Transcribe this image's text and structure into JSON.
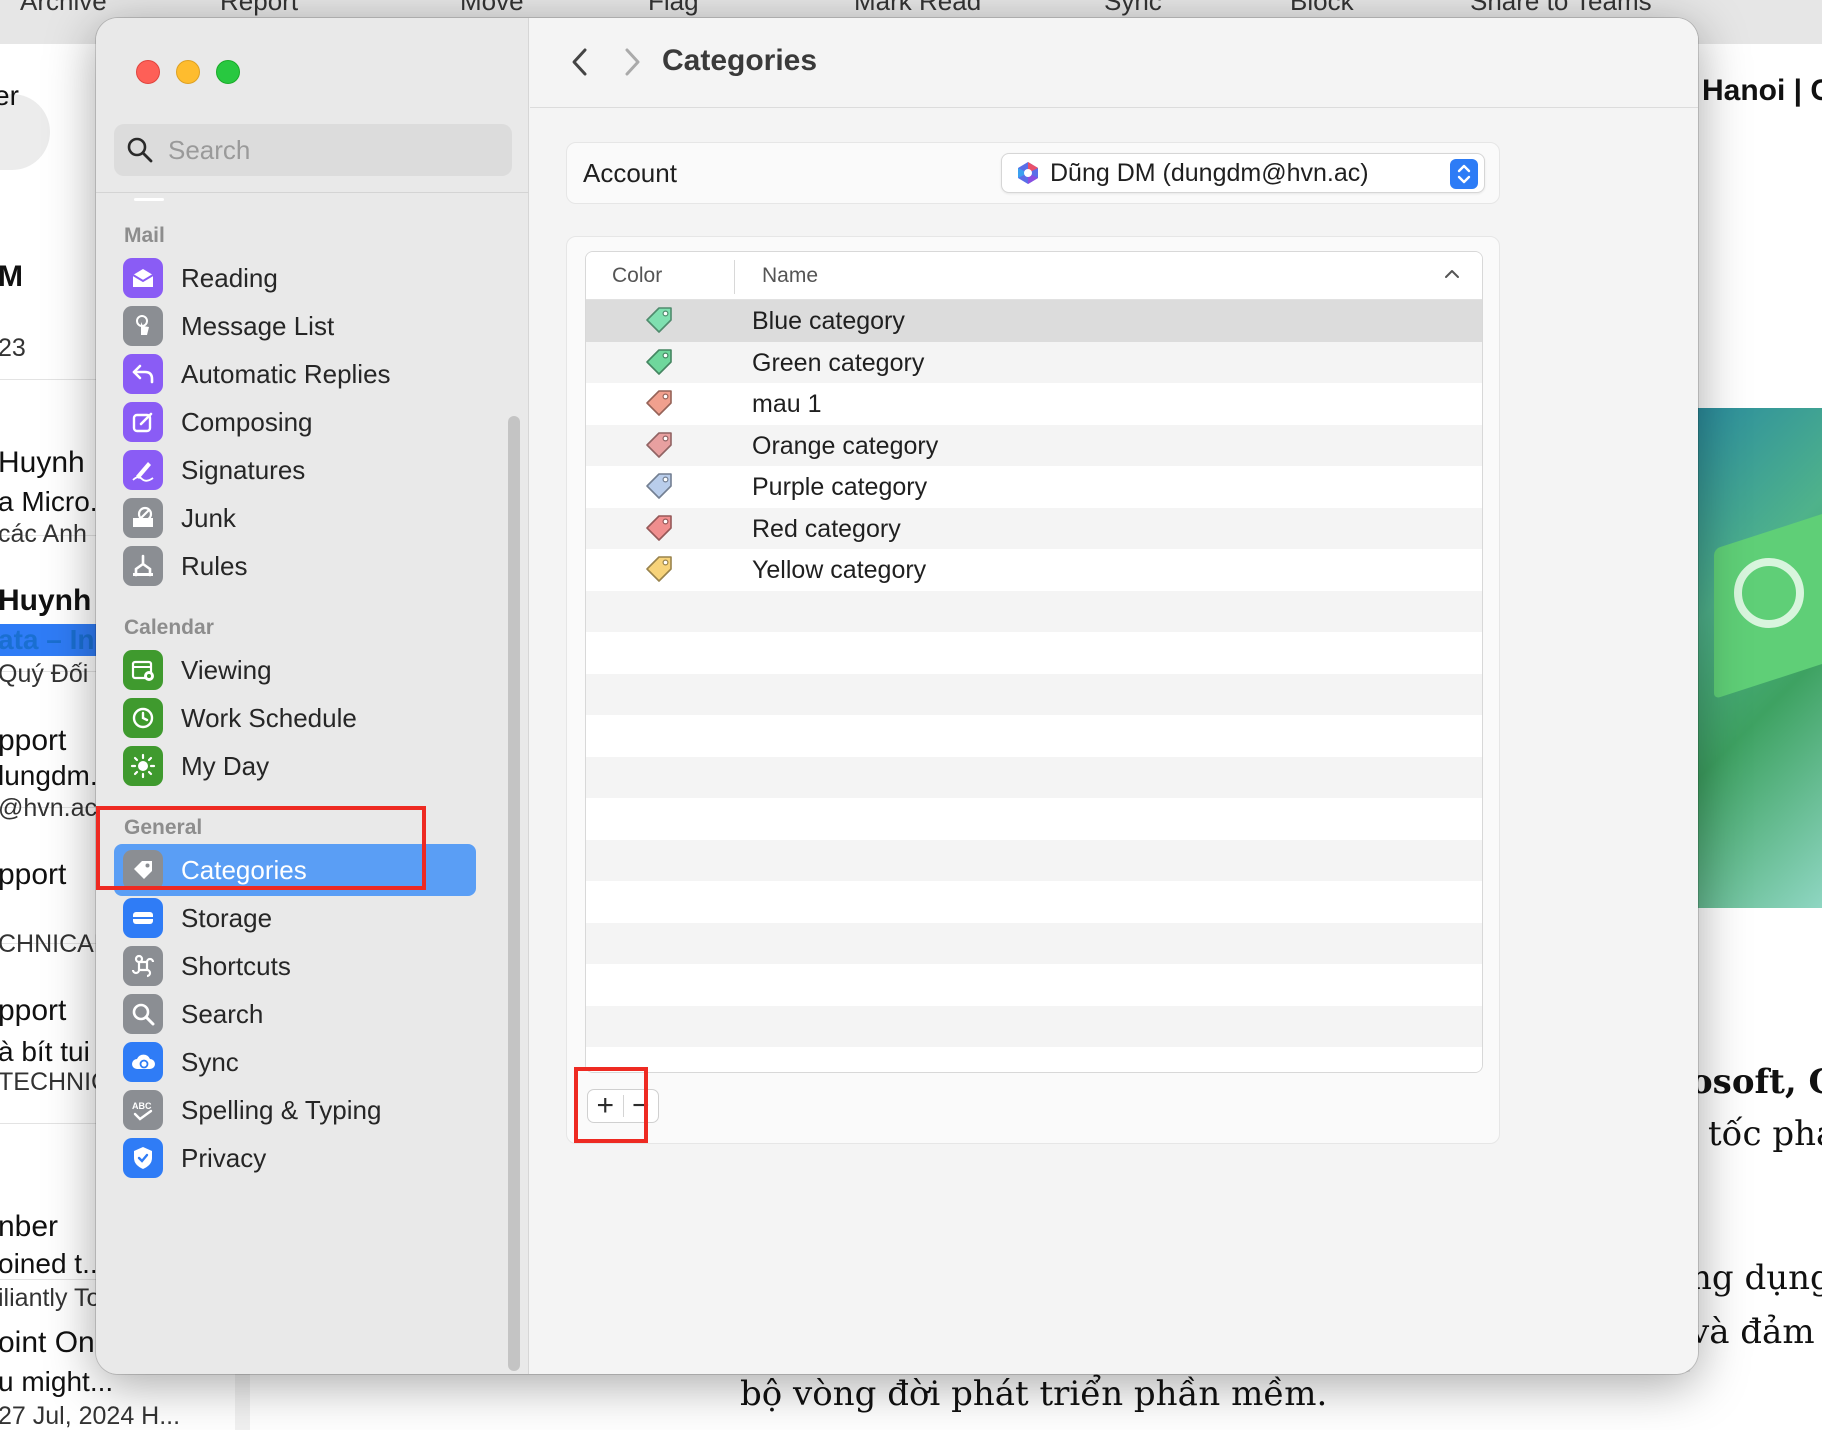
{
  "background": {
    "toolbar": [
      "Archive",
      "Report",
      "Move",
      "Flag",
      "Mark Read",
      "Sync",
      "Block",
      "Share to Teams"
    ],
    "left_snippets": {
      "filter_label": "er",
      "items": [
        {
          "lines": [
            "M",
            "23"
          ]
        },
        {
          "lines": [
            "Huynh",
            "a Micro...",
            "các Anh"
          ]
        },
        {
          "lines": [
            "Huynh",
            "ata – In...",
            "Quý Đối"
          ]
        },
        {
          "lines": [
            "pport",
            "lungdm...",
            "@hvn.ac"
          ]
        },
        {
          "lines": [
            "pport",
            "CHNICAL"
          ]
        },
        {
          "lines": [
            "pport",
            "à bít tui",
            "TECHNIC"
          ]
        },
        {
          "lines": [
            "nber",
            "oined t...",
            "iliantly To"
          ]
        },
        {
          "lines": [
            "oint On",
            "u might...",
            "27 Jul, 2024 H..."
          ]
        }
      ]
    },
    "right_snippets": {
      "heading": "Hanoi | C",
      "serif_lines": [
        "osoft, G",
        "tốc phát",
        "ng dụng",
        "và đảm b"
      ]
    },
    "bottom_text": "bộ vòng đời phát triển phần mềm."
  },
  "sidebar": {
    "search_placeholder": "Search",
    "sections": [
      {
        "title": "Mail",
        "items": [
          {
            "label": "Reading",
            "icon": "envelope-open-icon",
            "color": "#8a5cf5"
          },
          {
            "label": "Message List",
            "icon": "hand-pointer-icon",
            "color": "#8b8e93"
          },
          {
            "label": "Automatic Replies",
            "icon": "reply-arrow-icon",
            "color": "#8a5cf5"
          },
          {
            "label": "Composing",
            "icon": "compose-pencil-icon",
            "color": "#8a5cf5"
          },
          {
            "label": "Signatures",
            "icon": "signature-pen-icon",
            "color": "#8a5cf5"
          },
          {
            "label": "Junk",
            "icon": "junk-tray-icon",
            "color": "#8b8e93"
          },
          {
            "label": "Rules",
            "icon": "rules-branch-icon",
            "color": "#8b8e93"
          }
        ]
      },
      {
        "title": "Calendar",
        "items": [
          {
            "label": "Viewing",
            "icon": "calendar-gear-icon",
            "color": "#3f9a2e"
          },
          {
            "label": "Work Schedule",
            "icon": "clock-icon",
            "color": "#3f9a2e"
          },
          {
            "label": "My Day",
            "icon": "sun-icon",
            "color": "#3f9a2e"
          }
        ]
      },
      {
        "title": "General",
        "items": [
          {
            "label": "Categories",
            "icon": "tag-icon",
            "color": "#8b8e93",
            "active": true
          },
          {
            "label": "Storage",
            "icon": "storage-drive-icon",
            "color": "#2f7cf6"
          },
          {
            "label": "Shortcuts",
            "icon": "command-key-icon",
            "color": "#8b8e93"
          },
          {
            "label": "Search",
            "icon": "magnifier-icon",
            "color": "#8b8e93"
          },
          {
            "label": "Sync",
            "icon": "cloud-sync-icon",
            "color": "#2f7cf6"
          },
          {
            "label": "Spelling & Typing",
            "icon": "abc-check-icon",
            "color": "#8b8e93"
          },
          {
            "label": "Privacy",
            "icon": "shield-check-icon",
            "color": "#2f7cf6"
          }
        ]
      }
    ]
  },
  "content": {
    "title": "Categories",
    "account": {
      "label": "Account",
      "selected": "Dũng DM (dungdm@hvn.ac)"
    },
    "table": {
      "columns": [
        "Color",
        "Name"
      ],
      "sort": "ascending",
      "rows": [
        {
          "name": "Blue category",
          "color": "#7fe0b0",
          "selected": true
        },
        {
          "name": "Green category",
          "color": "#6fd79c"
        },
        {
          "name": "mau 1",
          "color": "#f0a08e"
        },
        {
          "name": "Orange category",
          "color": "#e8a0a0"
        },
        {
          "name": "Purple category",
          "color": "#b9cdeb"
        },
        {
          "name": "Red category",
          "color": "#f08e8e"
        },
        {
          "name": "Yellow category",
          "color": "#f7d37a"
        }
      ],
      "empty_rows": 12
    },
    "add_button": "+",
    "remove_button": "−"
  },
  "highlight_color": "#ee2a22"
}
